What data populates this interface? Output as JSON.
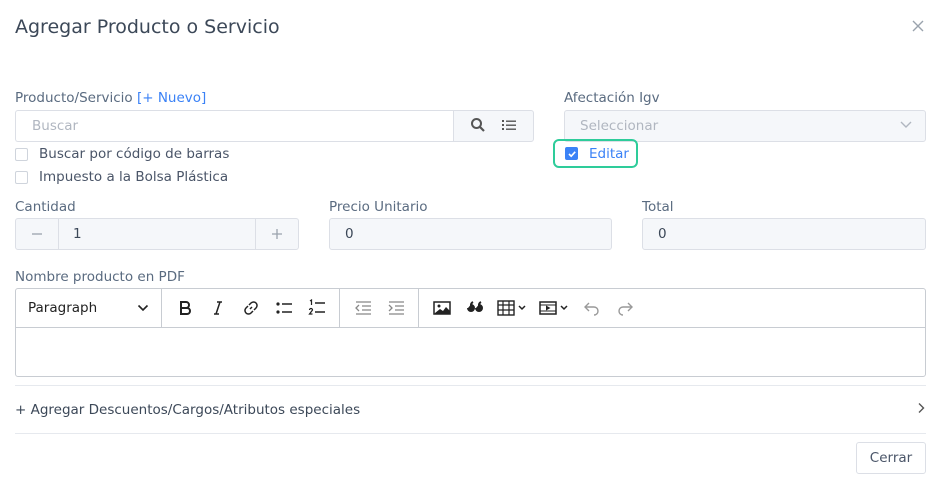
{
  "modal": {
    "title": "Agregar Producto o Servicio"
  },
  "product": {
    "label": "Producto/Servicio",
    "new_link": "[+ Nuevo]",
    "search_placeholder": "Buscar"
  },
  "igv": {
    "label": "Afectación Igv",
    "placeholder": "Seleccionar"
  },
  "checkboxes": {
    "barcode": {
      "label": "Buscar por código de barras",
      "checked": false
    },
    "bag_tax": {
      "label": "Impuesto a la Bolsa Plástica",
      "checked": false
    },
    "edit": {
      "label": "Editar",
      "checked": true
    }
  },
  "quantity": {
    "label": "Cantidad",
    "value": "1"
  },
  "unit_price": {
    "label": "Precio Unitario",
    "value": "0"
  },
  "total": {
    "label": "Total",
    "value": "0"
  },
  "pdf_name": {
    "label": "Nombre producto en PDF",
    "format": "Paragraph"
  },
  "extras": {
    "label": "+ Agregar Descuentos/Cargos/Atributos especiales"
  },
  "footer": {
    "close_label": "Cerrar"
  },
  "colors": {
    "accent": "#3b82f6",
    "highlight": "#2ecc9a"
  }
}
